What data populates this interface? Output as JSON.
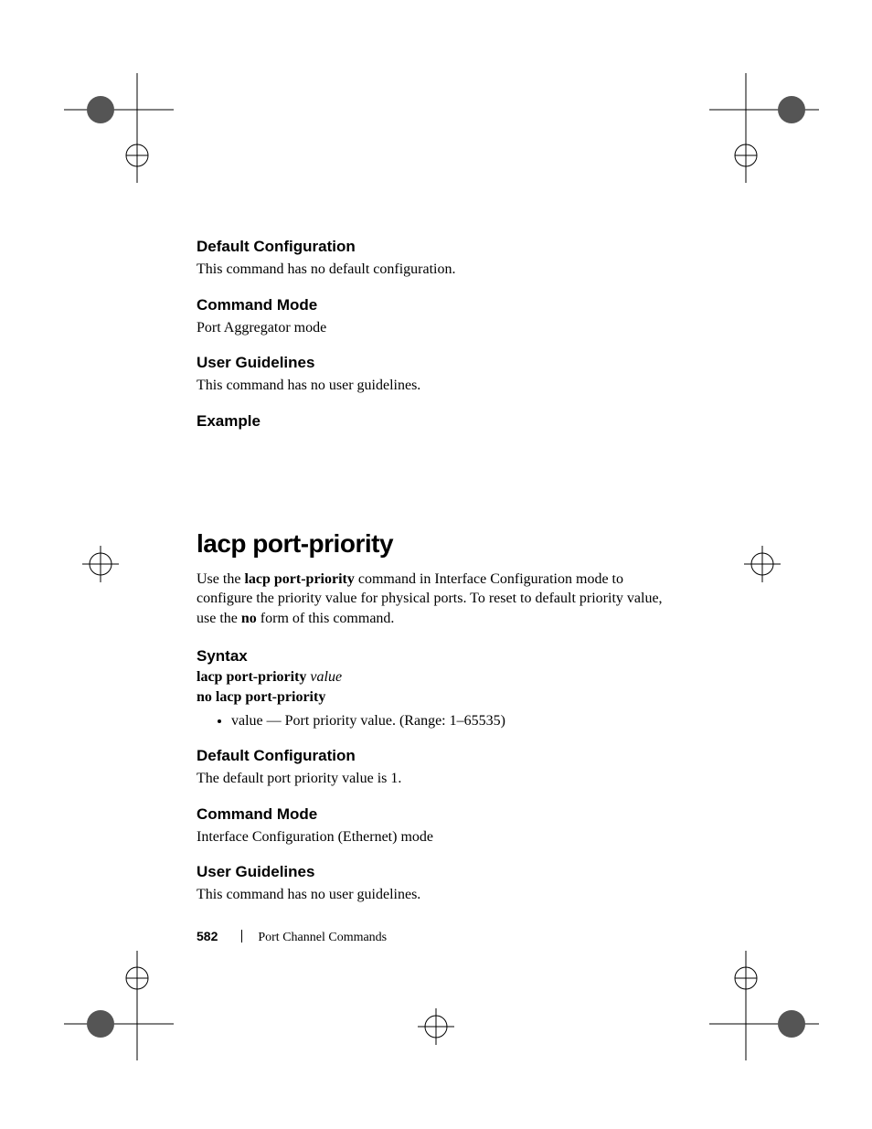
{
  "sec1": {
    "h1": "Default Configuration",
    "p1": "This command has no default configuration.",
    "h2": "Command Mode",
    "p2": "Port Aggregator mode",
    "h3": "User Guidelines",
    "p3": "This command has no user guidelines.",
    "h4": "Example"
  },
  "sec2": {
    "title": "lacp port-priority",
    "intro_pre": "Use the ",
    "intro_bold": "lacp port-priority",
    "intro_mid": " command in Interface Configuration mode to configure the priority value for physical ports. To reset to default priority value, use the ",
    "intro_bold2": "no",
    "intro_post": " form of this command.",
    "syntax_h": "Syntax",
    "syntax_cmd": "lacp port-priority",
    "syntax_arg": "value",
    "syntax_no": "no lacp port-priority",
    "bullet_arg": "value",
    "bullet_rest": " — Port priority value. (Range: 1–65535)",
    "h1": "Default Configuration",
    "p1": "The default port priority value is 1.",
    "h2": "Command Mode",
    "p2": "Interface Configuration (Ethernet) mode",
    "h3": "User Guidelines",
    "p3": "This command has no user guidelines."
  },
  "footer": {
    "page": "582",
    "section": "Port Channel Commands"
  }
}
